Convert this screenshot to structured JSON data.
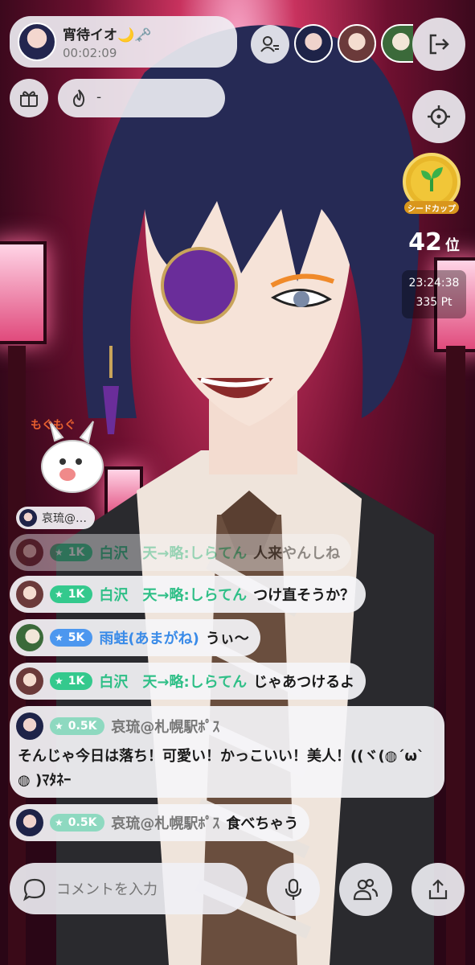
{
  "streamer": {
    "name": "宵待イオ🌙🗝️",
    "elapsed": "00:02:09"
  },
  "heat": {
    "value": "-"
  },
  "ranking": {
    "cup_label": "シードカップ",
    "rank_number": "42",
    "rank_suffix": "位",
    "time": "23:24:38",
    "points": "335 Pt"
  },
  "sticker": {
    "text": "もぐもぐ"
  },
  "viewer_join": {
    "name": "哀琉@…"
  },
  "comments": [
    {
      "badge": "1K",
      "user": "白沢　天→略:しらてん",
      "text": "人来やんしね"
    },
    {
      "badge": "1K",
      "user": "白沢　天→略:しらてん",
      "text": "つけ直そうか？"
    },
    {
      "badge": "5K",
      "user": "雨蛙(あまがね)",
      "text": "うぃ〜"
    },
    {
      "badge": "1K",
      "user": "白沢　天→略:しらてん",
      "text": "じゃあつけるよ"
    },
    {
      "badge": "0.5K",
      "user": "哀琉@札幌駅ﾎﾟｽ",
      "text": "そんじゃ今日は落ち！可愛い！かっこいい！美人！((ヾ(◍´ω`◍ )ﾏﾀﾈｰ"
    },
    {
      "badge": "0.5K",
      "user": "哀琉@札幌駅ﾎﾟｽ",
      "text": "食べちゃう"
    }
  ],
  "input": {
    "placeholder": "コメントを入力"
  },
  "colors": {
    "green": "#2fbf87",
    "blue": "#3a8be8",
    "pill": "#f0f0f5"
  }
}
